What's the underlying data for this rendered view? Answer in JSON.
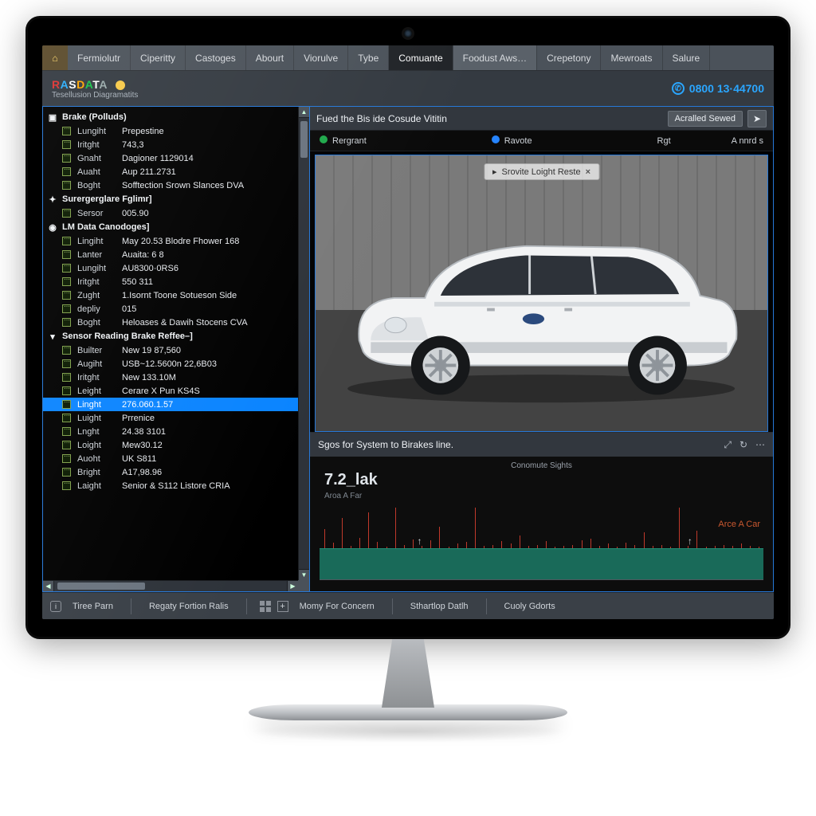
{
  "menu": {
    "items": [
      "Fermiolutr",
      "Ciperitty",
      "Castoges",
      "Abourt",
      "Viorulve",
      "Tybe",
      "Comuante",
      "Foodust Aws…",
      "Crepetony",
      "Mewroats",
      "Salure"
    ],
    "active_index": 6
  },
  "brand": {
    "logo_parts": {
      "p1": "R",
      "p2": "A",
      "p3": "S",
      "p4": "D",
      "p5": "A",
      "p6": "T",
      "p7": "A"
    },
    "subtitle": "Tesellusion Diagramatits",
    "phone": "0800 13·44700"
  },
  "sidebar": {
    "groups": [
      {
        "icon": "battery-icon",
        "label": "Brake (Polluds)",
        "rows": [
          {
            "k": "Lungiht",
            "v": "Prepestine"
          },
          {
            "k": "Iritght",
            "v": "743,3"
          },
          {
            "k": "Gnaht",
            "v": "Dagioner 1129014"
          },
          {
            "k": "Auaht",
            "v": "Aup 211.2731"
          },
          {
            "k": "Boght",
            "v": "Sofftection Srown Slances DVA"
          }
        ]
      },
      {
        "icon": "wrench-icon",
        "label": "Surergerglare Fglimr]",
        "rows": [
          {
            "k": "Sersor",
            "v": "005.90"
          }
        ]
      },
      {
        "icon": "info-icon",
        "label": "LM Data Canodoges]",
        "rows": [
          {
            "k": "Lingiht",
            "v": "May 20.53 Blodre Fhower 168"
          },
          {
            "k": "Lanter",
            "v": "Auaita: 6 8"
          },
          {
            "k": "Lungiht",
            "v": "AU8300·0RS6"
          },
          {
            "k": "Iritght",
            "v": "550 311"
          },
          {
            "k": "Zught",
            "v": "1.Isornt Toone Sotueson Side"
          },
          {
            "k": "depliy",
            "v": "015"
          },
          {
            "k": "Boght",
            "v": "Heloases & Dawih Stocens CVA"
          }
        ]
      },
      {
        "icon": "chevron-icon",
        "label": "Sensor Reading Brake Reffee–]",
        "rows": [
          {
            "k": "Builter",
            "v": "New 19 87,560"
          },
          {
            "k": "Augiht",
            "v": "USB~12.5600n 22,6B03"
          },
          {
            "k": "Iritght",
            "v": "New 133.10M"
          },
          {
            "k": "Leight",
            "v": "Cerare X Pun KS4S"
          },
          {
            "k": "Linght",
            "v": "276.060.1.57",
            "selected": true
          },
          {
            "k": "Luight",
            "v": "Prrenice"
          },
          {
            "k": "Lnght",
            "v": "24.38 3101"
          },
          {
            "k": "Loight",
            "v": "Mew30.12"
          },
          {
            "k": "Auoht",
            "v": "UK S811"
          },
          {
            "k": "Bright",
            "v": "A17,98.96"
          },
          {
            "k": "Laight",
            "v": "Senior & S112 Listore CRIA"
          }
        ]
      }
    ]
  },
  "main": {
    "title": "Fued the Bis ide Cosude Vititin",
    "action_button": "Acralled Sewed",
    "sub": {
      "left": "Rergrant",
      "mid": "Ravote",
      "r1": "Rgt",
      "r2": "A nnrd s"
    },
    "overlay": "Srovite Loight Reste"
  },
  "chart_data": {
    "type": "line",
    "title": "Sgos for System to Birakes line.",
    "ylabel_main": "7.2_lak",
    "ylabel_sub": "Aroa A Far",
    "legend": "Conomute\nSights",
    "right_label": "Arce A Car",
    "band": {
      "from": 0,
      "to": 2.0
    },
    "ylim": [
      0,
      10
    ],
    "x": [
      0,
      1,
      2,
      3,
      4,
      5,
      6,
      7,
      8,
      9,
      10,
      11,
      12,
      13,
      14,
      15,
      16,
      17,
      18,
      19,
      20,
      21,
      22,
      23,
      24,
      25,
      26,
      27,
      28,
      29,
      30,
      31,
      32,
      33,
      34,
      35,
      36,
      37,
      38,
      39,
      40,
      41,
      42,
      43,
      44,
      45,
      46,
      47,
      48,
      49
    ],
    "spikes": [
      2.1,
      0.6,
      3.4,
      0.3,
      1.2,
      4.0,
      0.7,
      0.2,
      5.6,
      0.4,
      1.0,
      0.3,
      0.9,
      2.4,
      0.2,
      0.5,
      0.7,
      6.2,
      0.3,
      0.4,
      0.8,
      0.5,
      1.4,
      0.3,
      0.4,
      0.8,
      0.2,
      0.3,
      0.4,
      0.9,
      1.1,
      0.3,
      0.5,
      0.2,
      0.6,
      0.4,
      1.8,
      0.3,
      0.4,
      0.2,
      5.4,
      0.3,
      2.0,
      0.2,
      0.3,
      0.4,
      0.3,
      0.5,
      0.3,
      0.2
    ],
    "arrows": [
      "↑",
      "↑"
    ]
  },
  "footer": {
    "b1": "Tiree Parn",
    "b2": "Regaty Fortion Ralis",
    "b3": "Momy For Concern",
    "b4": "Sthartlop Datlh",
    "b5": "Cuoly Gdorts"
  }
}
